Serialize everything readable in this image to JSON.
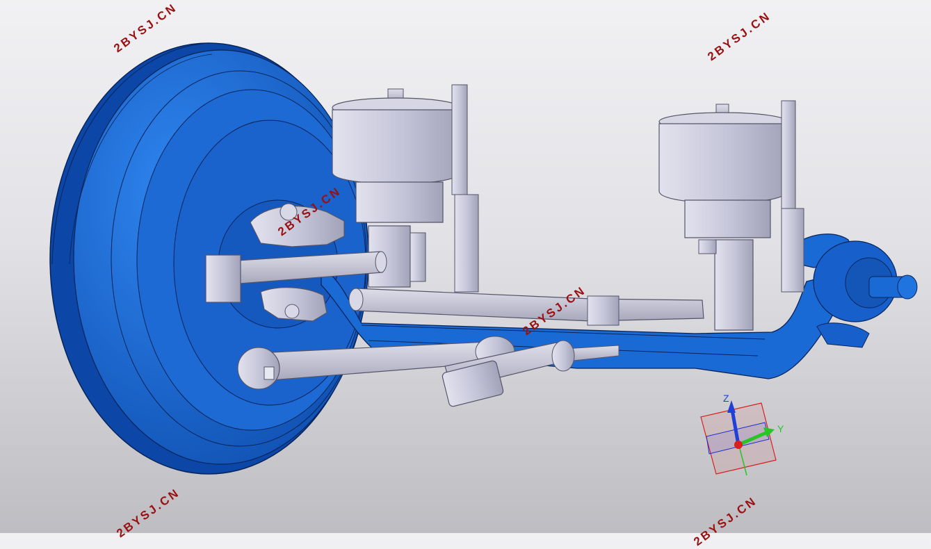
{
  "watermarks": [
    "2BYSJ.CN",
    "2BYSJ.CN",
    "2BYSJ.CN",
    "2BYSJ.CN",
    "2BYSJ.CN",
    "2BYSJ.CN"
  ],
  "triad": {
    "z_label": "Z",
    "y_label": "Y"
  },
  "colors": {
    "part_blue": "#1a6ad6",
    "part_blue_dark": "#0d3f8f",
    "part_grey": "#c4c4d8",
    "part_grey_dark": "#8d8da4",
    "watermark": "#9a1010",
    "axis_z": "#1e3fd8",
    "axis_y": "#28c428",
    "axis_x": "#d82020"
  }
}
